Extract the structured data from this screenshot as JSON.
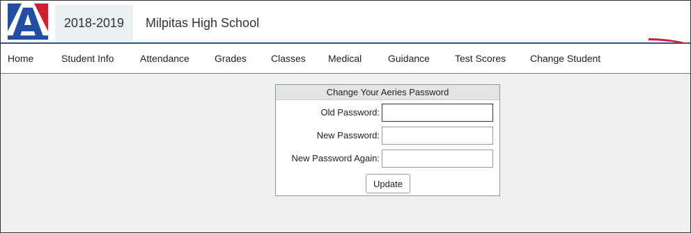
{
  "header": {
    "logo_icon": "aeries-a-logo",
    "year": "2018-2019",
    "school": "Milpitas High School"
  },
  "nav": {
    "items": [
      {
        "label": "Home"
      },
      {
        "label": "Student Info"
      },
      {
        "label": "Attendance"
      },
      {
        "label": "Grades"
      },
      {
        "label": "Classes"
      },
      {
        "label": "Medical"
      },
      {
        "label": "Guidance"
      },
      {
        "label": "Test Scores"
      },
      {
        "label": "Change Student"
      }
    ]
  },
  "password_form": {
    "title": "Change Your Aeries Password",
    "old_label": "Old Password:",
    "old_value": "",
    "new_label": "New Password:",
    "new_value": "",
    "again_label": "New Password Again:",
    "again_value": "",
    "update_label": "Update"
  },
  "colors": {
    "brand_blue": "#1f4ea3",
    "brand_red": "#d0202e",
    "header_rule": "#2f4f8f"
  }
}
